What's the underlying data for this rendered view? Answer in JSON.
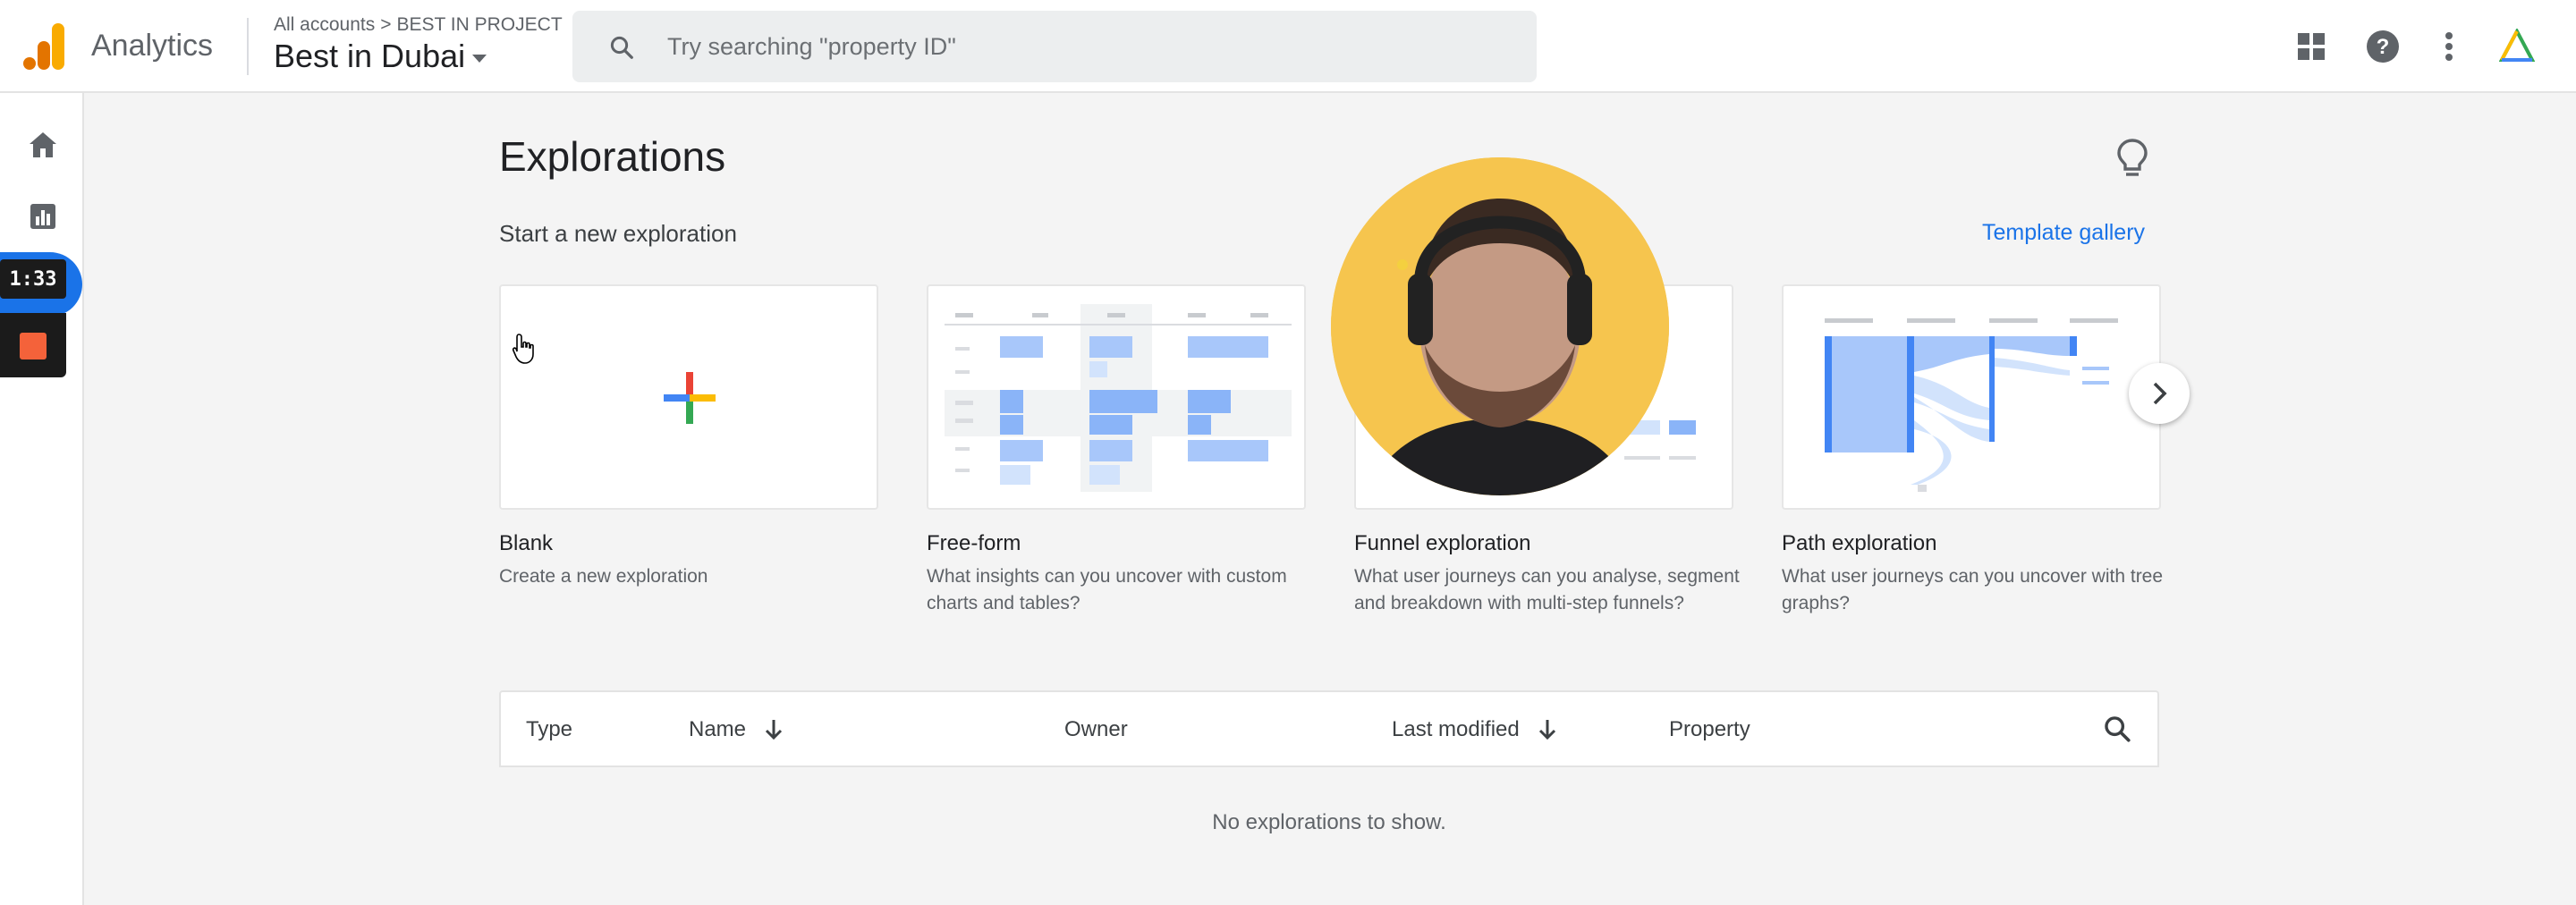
{
  "header": {
    "app_name": "Analytics",
    "breadcrumb_root": "All accounts",
    "breadcrumb_separator": ">",
    "breadcrumb_account": "BEST IN PROJECT",
    "property_name": "Best in Dubai",
    "search_placeholder": "Try searching \"property ID\"",
    "icons": [
      "apps-grid-icon",
      "help-icon",
      "more-vert-icon",
      "product-logo-icon"
    ]
  },
  "left_rail": {
    "items": [
      "home-icon",
      "reports-icon",
      "explore-icon"
    ]
  },
  "recorder": {
    "timer": "1:33",
    "stop_color": "#f4623a"
  },
  "main": {
    "title": "Explorations",
    "subtitle": "Start a new exploration",
    "template_gallery_label": "Template gallery",
    "cards": [
      {
        "title": "Blank",
        "description": "Create a new exploration"
      },
      {
        "title": "Free-form",
        "description": "What insights can you uncover with custom charts and tables?"
      },
      {
        "title": "Funnel exploration",
        "description": "What user journeys can you analyse, segment and breakdown with multi-step funnels?"
      },
      {
        "title": "Path exploration",
        "description": "What user journeys can you uncover with tree graphs?"
      }
    ]
  },
  "table": {
    "columns": [
      "Type",
      "Name",
      "Owner",
      "Last modified",
      "Property"
    ],
    "empty_message": "No explorations to show."
  },
  "colors": {
    "accent": "#1a73e8",
    "chart_blue": "#a8c7fa",
    "chart_blue_dark": "#8ab4f8",
    "logo_orange": "#f9ab00",
    "logo_orange_dark": "#e37400",
    "webcam_bg": "#f6c54e"
  }
}
